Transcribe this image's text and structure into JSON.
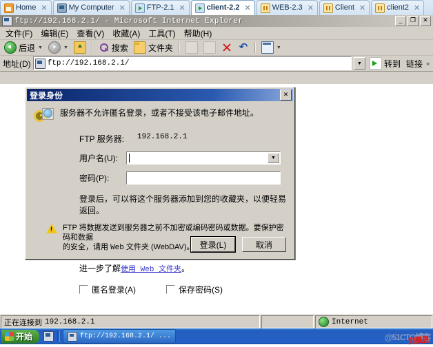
{
  "vm_tabs": [
    {
      "label": "Home",
      "icon": "home-icon",
      "state": "none",
      "active": false
    },
    {
      "label": "My Computer",
      "icon": "monitor-icon",
      "state": "none",
      "active": false
    },
    {
      "label": "FTP-2.1",
      "icon": "vm-running-icon",
      "state": "running",
      "active": false
    },
    {
      "label": "client-2.2",
      "icon": "vm-running-icon",
      "state": "running",
      "active": true
    },
    {
      "label": "WEB-2.3",
      "icon": "vm-suspended-icon",
      "state": "suspended",
      "active": false
    },
    {
      "label": "Client",
      "icon": "vm-suspended-icon",
      "state": "suspended",
      "active": false
    },
    {
      "label": "client2",
      "icon": "vm-suspended-icon",
      "state": "suspended",
      "active": false
    }
  ],
  "tab_close_glyph": "✕",
  "window": {
    "title": "ftp://192.168.2.1/ - Microsoft Internet Explorer",
    "icon": "ie-icon",
    "minimize": "_",
    "maximize": "❐",
    "close": "✕"
  },
  "menu": [
    {
      "label": "文件(F)"
    },
    {
      "label": "编辑(E)"
    },
    {
      "label": "查看(V)"
    },
    {
      "label": "收藏(A)"
    },
    {
      "label": "工具(T)"
    },
    {
      "label": "帮助(H)"
    }
  ],
  "toolbar": {
    "back": "后退",
    "search": "搜索",
    "folders": "文件夹",
    "dropdown_glyph": "▼"
  },
  "address": {
    "label": "地址(D)",
    "value": "ftp://192.168.2.1/",
    "dropdown_glyph": "▼",
    "go_label": "转到",
    "links_label": "链接",
    "chevron": "»"
  },
  "dialog": {
    "title": "登录身份",
    "close_glyph": "✕",
    "message": "服务器不允许匿名登录，或者不接受该电子邮件地址。",
    "server_label": "FTP 服务器:",
    "server_value": "192.168.2.1",
    "username_label": "用户名(U):",
    "username_value": "",
    "password_label": "密码(P):",
    "password_value": "",
    "hint": "登录后，可以将这个服务器添加到您的收藏夹，以便轻易返回。",
    "warning_line1": "FTP 将数据发送到服务器之前不加密或编码密码或数据。要保护密码和数据",
    "warning_line2_prefix": "的安全，请用 ",
    "warning_line2_mono": "Web",
    "warning_line2_suffix": " 文件夹 (WebDAV)。",
    "learn_prefix": "进一步了解",
    "learn_link": "使用 Web 文件夹",
    "learn_suffix": "。",
    "anonymous_label": "匿名登录(A)",
    "anonymous_checked": false,
    "savepass_label": "保存密码(S)",
    "savepass_checked": false,
    "login_button": "登录(L)",
    "cancel_button": "取消",
    "combo_glyph": "▼"
  },
  "statusbar": {
    "message_prefix": "正在连接到",
    "message_value": "192.168.2.1",
    "zone": "Internet",
    "zone_icon": "globe-icon"
  },
  "taskbar": {
    "start_label": "开始",
    "quicklaunch_icon": "ie-icon",
    "task_label": "ftp://192.168.2.1/ ...",
    "watermark": "@51CTO博客",
    "signature": "刘晨昱"
  }
}
